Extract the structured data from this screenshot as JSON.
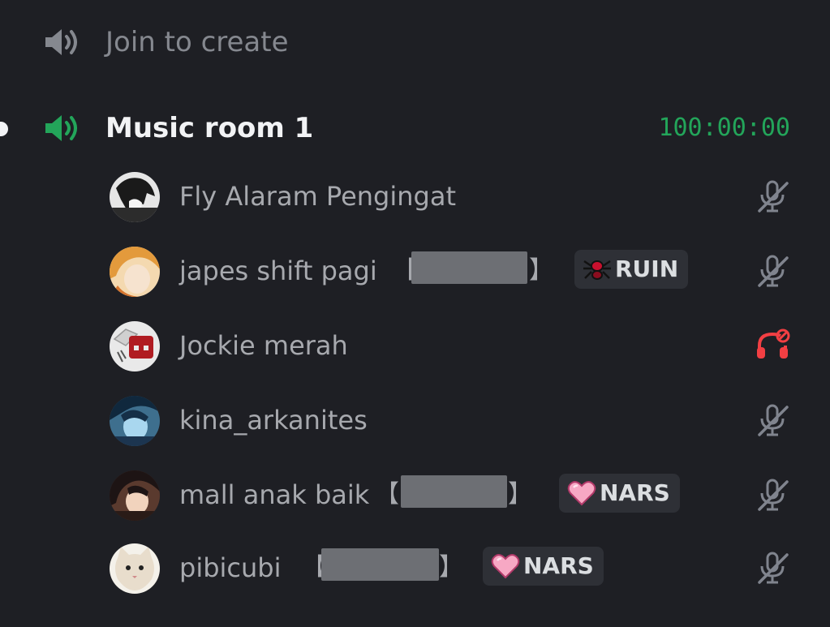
{
  "channels": {
    "join": {
      "label": "Join to create"
    },
    "music": {
      "label": "Music room 1",
      "timer": "100:00:00"
    }
  },
  "users": [
    {
      "name": "Fly Alaram Pengingat",
      "bracket_open": "",
      "bracket_close": "",
      "tag": null,
      "status": "mic-muted-icon"
    },
    {
      "name": "japes shift pagi",
      "bracket_open": "【",
      "bracket_close": "】",
      "tag": {
        "label": "RUIN",
        "icon": "spider-icon"
      },
      "status": "mic-muted-icon"
    },
    {
      "name": "Jockie merah",
      "bracket_open": "",
      "bracket_close": "",
      "tag": null,
      "status": "deafened-icon"
    },
    {
      "name": "kina_arkanites",
      "bracket_open": "",
      "bracket_close": "",
      "tag": null,
      "status": "mic-muted-icon"
    },
    {
      "name": "mall anak baik",
      "bracket_open": "【",
      "bracket_close": "】",
      "tag": {
        "label": "NARS",
        "icon": "heart-icon"
      },
      "status": "mic-muted-icon"
    },
    {
      "name": "pibicubi",
      "bracket_open": "【",
      "bracket_close": "】",
      "tag": {
        "label": "NARS",
        "icon": "heart-icon"
      },
      "status": "mic-muted-icon"
    }
  ],
  "colors": {
    "background": "#1e1f24",
    "active_green": "#23a55a",
    "muted_icon": "#80848e",
    "deafened_red": "#f23f43",
    "tag_background": "#2e3036"
  }
}
